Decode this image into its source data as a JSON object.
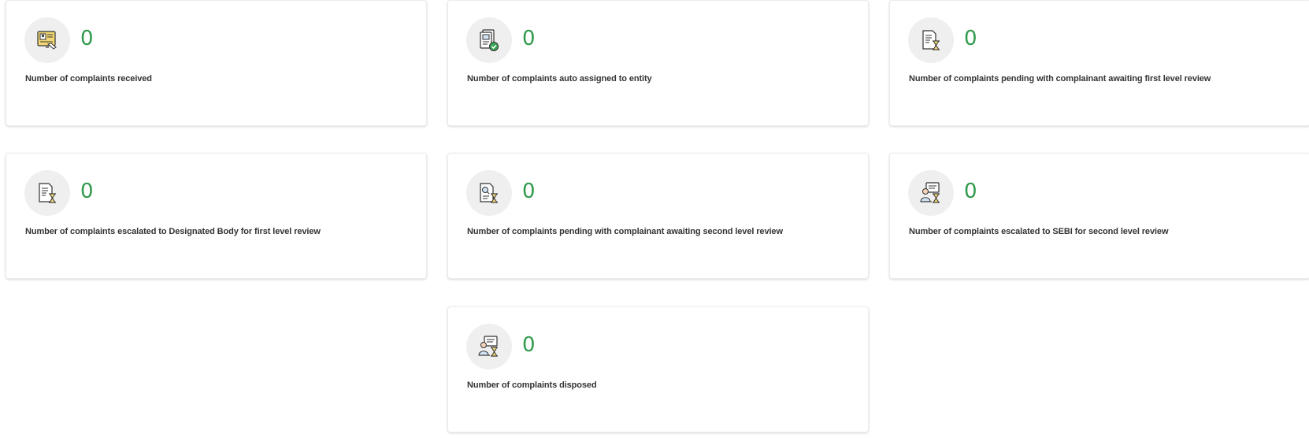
{
  "cards": [
    {
      "count": "0",
      "label": "Number of complaints received",
      "icon": "complaint-form-icon"
    },
    {
      "count": "0",
      "label": "Number of complaints auto assigned to entity",
      "icon": "document-check-icon"
    },
    {
      "count": "0",
      "label": "Number of complaints pending with complainant awaiting first level review",
      "icon": "document-hourglass-icon"
    },
    {
      "count": "0",
      "label": "Number of complaints escalated to Designated Body for first level review",
      "icon": "document-hourglass-icon"
    },
    {
      "count": "0",
      "label": "Number of complaints pending with complainant awaiting second level review",
      "icon": "document-search-hourglass-icon"
    },
    {
      "count": "0",
      "label": "Number of complaints escalated to SEBI for second level review",
      "icon": "reviewer-hourglass-icon"
    },
    {
      "count": "0",
      "label": "Number of complaints disposed",
      "icon": "reviewer-hourglass-icon"
    }
  ],
  "colors": {
    "count": "#2f9a4c",
    "icon_bg": "#efefef",
    "label": "#333333"
  }
}
